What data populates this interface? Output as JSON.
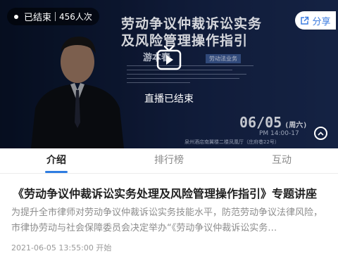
{
  "status": {
    "label": "已结束",
    "viewers": "456人次"
  },
  "share": {
    "label": "分享"
  },
  "poster": {
    "title_line1": "劳动争议仲裁诉讼实务",
    "title_line2": "及风险管理操作指引",
    "speaker": "游本春",
    "speaker_tag": "劳动法业务",
    "date": "06/05",
    "weekday": "(周六)",
    "time": "PM 14:00-17",
    "venue": "泉州酒店南翼楼二楼凤凰厅（庄府巷22号）"
  },
  "player": {
    "ended_text": "直播已结束"
  },
  "tabs": [
    {
      "label": "介绍",
      "active": true
    },
    {
      "label": "排行榜",
      "active": false
    },
    {
      "label": "互动",
      "active": false
    }
  ],
  "article": {
    "title": "《劳动争议仲裁诉讼实务处理及风险管理操作指引》专题讲座",
    "description": "为提升全市律师对劳动争议仲裁诉讼实务技能水平，防范劳动争议法律风险，市律协劳动与社会保障委员会决定举办“《劳动争议仲裁诉讼实务…",
    "start_time": "2021-06-05 13:55:00 开始"
  },
  "colors": {
    "accent": "#2f7de1",
    "share_text": "#3a7be0"
  }
}
